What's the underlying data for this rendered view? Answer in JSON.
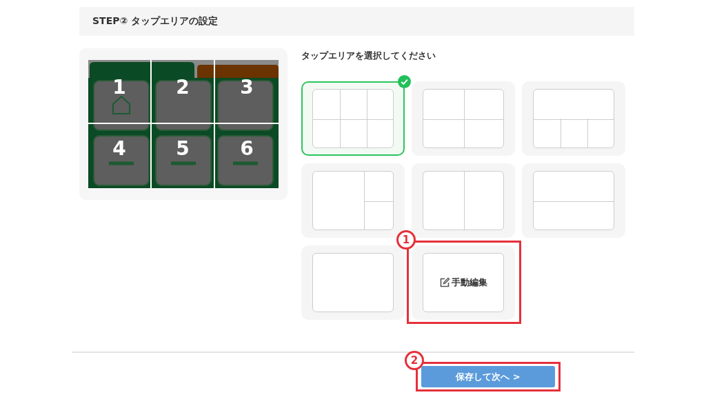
{
  "header": {
    "title": "STEP② タップエリアの設定"
  },
  "preview": {
    "kind": "picture",
    "zones": [
      "1",
      "2",
      "3",
      "4",
      "5",
      "6"
    ]
  },
  "prompt": "タップエリアを選択してください",
  "layouts": [
    {
      "kind": "six",
      "selected": true
    },
    {
      "kind": "four",
      "selected": false
    },
    {
      "kind": "one-three",
      "selected": false
    },
    {
      "kind": "one-two",
      "selected": false
    },
    {
      "kind": "two-columns",
      "selected": false
    },
    {
      "kind": "two-rows",
      "selected": false
    },
    {
      "kind": "single",
      "selected": false
    },
    {
      "kind": "manual",
      "label": "手動編集",
      "selected": false,
      "annotation": "1"
    }
  ],
  "save_button": {
    "label": "保存して次へ >",
    "annotation": "2"
  }
}
